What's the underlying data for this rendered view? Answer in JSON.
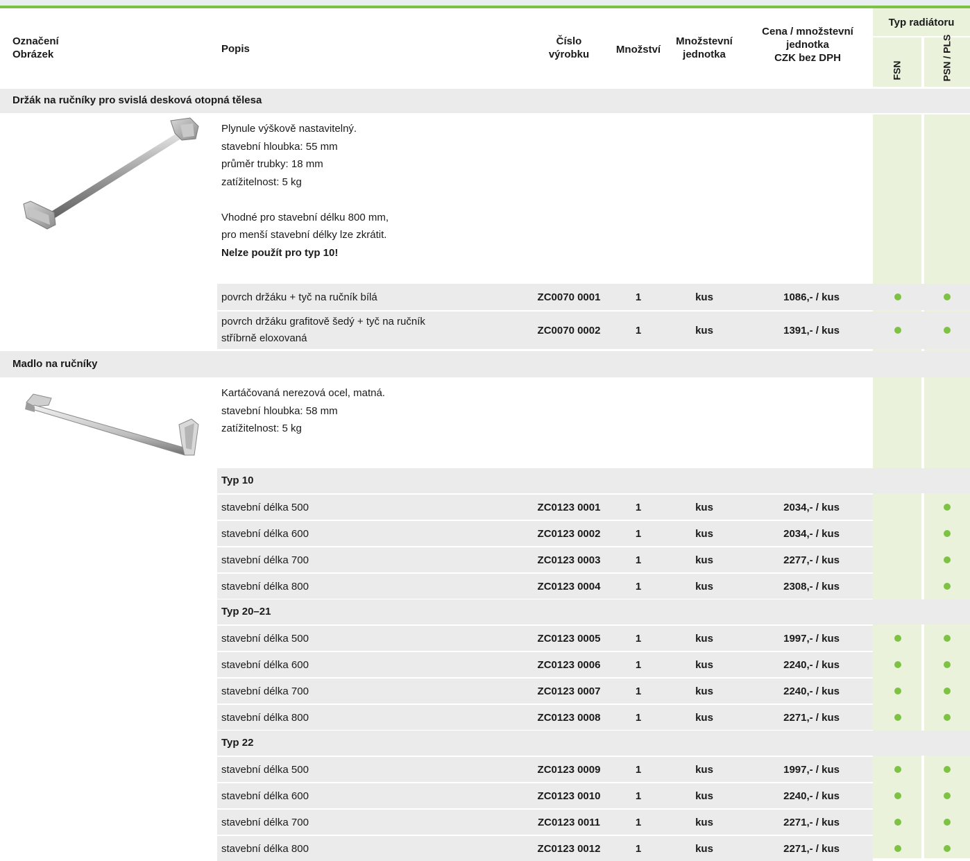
{
  "colors": {
    "accent": "#7dc242",
    "section_bg": "#ebebeb",
    "radiator_col_bg": "#eaf2dc"
  },
  "header": {
    "col1_line1": "Označení",
    "col1_line2": "Obrázek",
    "col2": "Popis",
    "col3_line1": "Číslo",
    "col3_line2": "výrobku",
    "col4": "Množství",
    "col5_line1": "Množstevní",
    "col5_line2": "jednotka",
    "col6_line1": "Cena / množstevní",
    "col6_line2": "jednotka",
    "col6_line3": "CZK bez DPH",
    "group": "Typ radiátoru",
    "sub1": "FSN",
    "sub2": "PSN / PLS"
  },
  "section1": {
    "title": "Držák na ručníky pro svislá desková otopná tělesa",
    "image_icon": "towel-rail-bar-image",
    "desc_lines": [
      "Plynule výškově nastavitelný.",
      "stavební hloubka: 55 mm",
      "průměr trubky: 18 mm",
      "zatížitelnost: 5 kg",
      "",
      "Vhodné pro stavební délku 800 mm,",
      "pro menší stavební délky lze zkrátit."
    ],
    "desc_bold": "Nelze použít pro typ 10!",
    "rows": [
      {
        "desc": "povrch držáku + tyč na ručník bílá",
        "code": "ZC0070 0001",
        "qty": "1",
        "unit": "kus",
        "price": "1086,- / kus"
      },
      {
        "desc": "povrch držáku grafitově šedý + tyč na ručník",
        "desc2": "stříbrně eloxovaná",
        "code": "ZC0070 0002",
        "qty": "1",
        "unit": "kus",
        "price": "1391,- / kus"
      }
    ]
  },
  "section2": {
    "title": "Madlo na ručníky",
    "image_icon": "towel-handle-image",
    "desc_lines": [
      "Kartáčovaná nerezová ocel, matná.",
      "stavební hloubka: 58 mm",
      "zatížitelnost: 5 kg"
    ],
    "groups": [
      {
        "title": "Typ 10",
        "rows": [
          {
            "desc": "stavební délka 500",
            "code": "ZC0123 0001",
            "qty": "1",
            "unit": "kus",
            "price": "2034,- / kus",
            "fsn": false,
            "psn": true
          },
          {
            "desc": "stavební délka 600",
            "code": "ZC0123 0002",
            "qty": "1",
            "unit": "kus",
            "price": "2034,- / kus",
            "fsn": false,
            "psn": true
          },
          {
            "desc": "stavební délka 700",
            "code": "ZC0123 0003",
            "qty": "1",
            "unit": "kus",
            "price": "2277,- / kus",
            "fsn": false,
            "psn": true
          },
          {
            "desc": "stavební délka 800",
            "code": "ZC0123 0004",
            "qty": "1",
            "unit": "kus",
            "price": "2308,- / kus",
            "fsn": false,
            "psn": true
          }
        ]
      },
      {
        "title": "Typ 20–21",
        "rows": [
          {
            "desc": "stavební délka 500",
            "code": "ZC0123 0005",
            "qty": "1",
            "unit": "kus",
            "price": "1997,- / kus",
            "fsn": true,
            "psn": true
          },
          {
            "desc": "stavební délka 600",
            "code": "ZC0123 0006",
            "qty": "1",
            "unit": "kus",
            "price": "2240,- / kus",
            "fsn": true,
            "psn": true
          },
          {
            "desc": "stavební délka 700",
            "code": "ZC0123 0007",
            "qty": "1",
            "unit": "kus",
            "price": "2240,- / kus",
            "fsn": true,
            "psn": true
          },
          {
            "desc": "stavební délka 800",
            "code": "ZC0123 0008",
            "qty": "1",
            "unit": "kus",
            "price": "2271,- / kus",
            "fsn": true,
            "psn": true
          }
        ]
      },
      {
        "title": "Typ 22",
        "rows": [
          {
            "desc": "stavební délka 500",
            "code": "ZC0123 0009",
            "qty": "1",
            "unit": "kus",
            "price": "1997,- / kus",
            "fsn": true,
            "psn": true
          },
          {
            "desc": "stavební délka 600",
            "code": "ZC0123 0010",
            "qty": "1",
            "unit": "kus",
            "price": "2240,- / kus",
            "fsn": true,
            "psn": true
          },
          {
            "desc": "stavební délka 700",
            "code": "ZC0123 0011",
            "qty": "1",
            "unit": "kus",
            "price": "2271,- / kus",
            "fsn": true,
            "psn": true
          },
          {
            "desc": "stavební délka 800",
            "code": "ZC0123 0012",
            "qty": "1",
            "unit": "kus",
            "price": "2271,- / kus",
            "fsn": true,
            "psn": true
          }
        ]
      }
    ]
  }
}
